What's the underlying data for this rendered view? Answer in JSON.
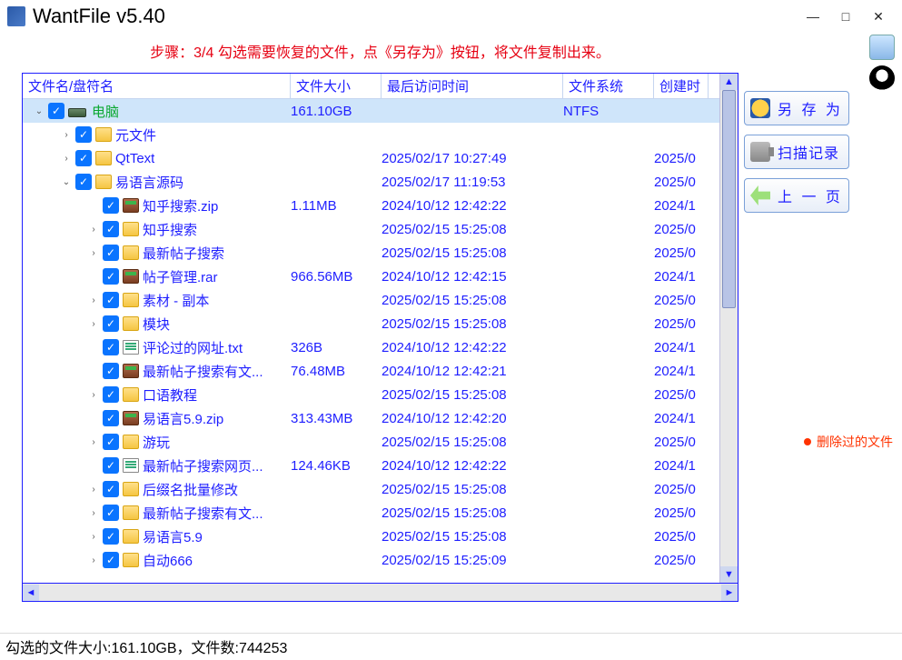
{
  "app": {
    "title": "WantFile v5.40"
  },
  "window_buttons": {
    "min": "—",
    "max": "□",
    "close": "✕"
  },
  "step_message": "步骤：3/4 勾选需要恢复的文件，点《另存为》按钮，将文件复制出来。",
  "columns": {
    "name": "文件名/盘符名",
    "size": "文件大小",
    "access_time": "最后访问时间",
    "fs": "文件系统",
    "created": "创建时"
  },
  "tree": [
    {
      "depth": 0,
      "expanded": true,
      "icon": "drive",
      "name": "电脑",
      "name_color": "green",
      "size": "161.10GB",
      "time": "",
      "fs": "NTFS",
      "created": "",
      "selected": true
    },
    {
      "depth": 1,
      "expanded": false,
      "icon": "folder",
      "name": "元文件",
      "size": "",
      "time": "",
      "fs": "",
      "created": ""
    },
    {
      "depth": 1,
      "expanded": false,
      "icon": "folder",
      "name": "QtText",
      "size": "",
      "time": "2025/02/17 10:27:49",
      "fs": "",
      "created": "2025/0"
    },
    {
      "depth": 1,
      "expanded": true,
      "icon": "folder",
      "name": "易语言源码",
      "size": "",
      "time": "2025/02/17 11:19:53",
      "fs": "",
      "created": "2025/0"
    },
    {
      "depth": 2,
      "expanded": null,
      "icon": "rar",
      "name": "知乎搜索.zip",
      "size": "1.11MB",
      "time": "2024/10/12 12:42:22",
      "fs": "",
      "created": "2024/1"
    },
    {
      "depth": 2,
      "expanded": false,
      "icon": "folder",
      "name": "知乎搜索",
      "size": "",
      "time": "2025/02/15 15:25:08",
      "fs": "",
      "created": "2025/0"
    },
    {
      "depth": 2,
      "expanded": false,
      "icon": "folder",
      "name": "最新帖子搜索",
      "size": "",
      "time": "2025/02/15 15:25:08",
      "fs": "",
      "created": "2025/0"
    },
    {
      "depth": 2,
      "expanded": null,
      "icon": "rar",
      "name": "帖子管理.rar",
      "size": "966.56MB",
      "time": "2024/10/12 12:42:15",
      "fs": "",
      "created": "2024/1"
    },
    {
      "depth": 2,
      "expanded": false,
      "icon": "folder",
      "name": "素材 - 副本",
      "size": "",
      "time": "2025/02/15 15:25:08",
      "fs": "",
      "created": "2025/0"
    },
    {
      "depth": 2,
      "expanded": false,
      "icon": "folder",
      "name": "模块",
      "size": "",
      "time": "2025/02/15 15:25:08",
      "fs": "",
      "created": "2025/0"
    },
    {
      "depth": 2,
      "expanded": null,
      "icon": "txt",
      "name": "评论过的网址.txt",
      "size": "326B",
      "time": "2024/10/12 12:42:22",
      "fs": "",
      "created": "2024/1"
    },
    {
      "depth": 2,
      "expanded": null,
      "icon": "rar",
      "name": "最新帖子搜索有文...",
      "size": "76.48MB",
      "time": "2024/10/12 12:42:21",
      "fs": "",
      "created": "2024/1"
    },
    {
      "depth": 2,
      "expanded": false,
      "icon": "folder",
      "name": "口语教程",
      "size": "",
      "time": "2025/02/15 15:25:08",
      "fs": "",
      "created": "2025/0"
    },
    {
      "depth": 2,
      "expanded": null,
      "icon": "rar",
      "name": "易语言5.9.zip",
      "size": "313.43MB",
      "time": "2024/10/12 12:42:20",
      "fs": "",
      "created": "2024/1"
    },
    {
      "depth": 2,
      "expanded": false,
      "icon": "folder",
      "name": "游玩",
      "size": "",
      "time": "2025/02/15 15:25:08",
      "fs": "",
      "created": "2025/0"
    },
    {
      "depth": 2,
      "expanded": null,
      "icon": "txt",
      "name": "最新帖子搜索网页...",
      "size": "124.46KB",
      "time": "2024/10/12 12:42:22",
      "fs": "",
      "created": "2024/1"
    },
    {
      "depth": 2,
      "expanded": false,
      "icon": "folder",
      "name": "后缀名批量修改",
      "size": "",
      "time": "2025/02/15 15:25:08",
      "fs": "",
      "created": "2025/0"
    },
    {
      "depth": 2,
      "expanded": false,
      "icon": "folder",
      "name": "最新帖子搜索有文...",
      "size": "",
      "time": "2025/02/15 15:25:08",
      "fs": "",
      "created": "2025/0"
    },
    {
      "depth": 2,
      "expanded": false,
      "icon": "folder",
      "name": "易语言5.9",
      "size": "",
      "time": "2025/02/15 15:25:08",
      "fs": "",
      "created": "2025/0"
    },
    {
      "depth": 2,
      "expanded": false,
      "icon": "folder",
      "name": "自动666",
      "size": "",
      "time": "2025/02/15 15:25:09",
      "fs": "",
      "created": "2025/0"
    }
  ],
  "buttons": {
    "save_as": "另 存 为",
    "scan_log": "扫描记录",
    "prev_page": "上 一 页"
  },
  "legend": {
    "deleted_files": "删除过的文件"
  },
  "status": {
    "prefix": "勾选的文件大小:",
    "size": "161.10GB",
    "sep": "，文件数:",
    "count": "744253"
  }
}
